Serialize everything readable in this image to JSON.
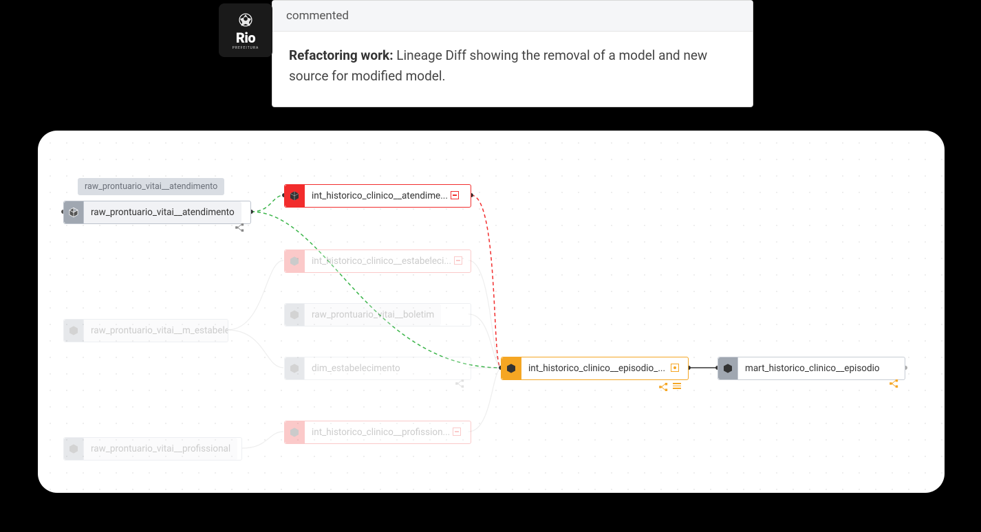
{
  "logo": {
    "text": "Rio",
    "subtitle": "PREFEITURA"
  },
  "comment": {
    "header": "commented",
    "title": "Refactoring work:",
    "body": "Lineage Diff showing the removal of a model and new source for modified model."
  },
  "selected_label": "raw_prontuario_vitai__atendimento",
  "nodes": {
    "raw_atendimento": "raw_prontuario_vitai__atendimento",
    "int_atendime": "int_historico_clinico__atendime...",
    "int_estabeleci": "int_historico_clinico__estabeleci...",
    "raw_boletim": "raw_prontuario_vitai__boletim",
    "raw_m_estabele": "raw_prontuario_vitai__m_estabele...",
    "dim_estabelecimento": "dim_estabelecimento",
    "int_profission": "int_historico_clinico__profission...",
    "raw_profissional": "raw_prontuario_vitai__profissional",
    "int_episodio": "int_historico_clinico__episodio_...",
    "mart_episodio": "mart_historico_clinico__episodio"
  }
}
